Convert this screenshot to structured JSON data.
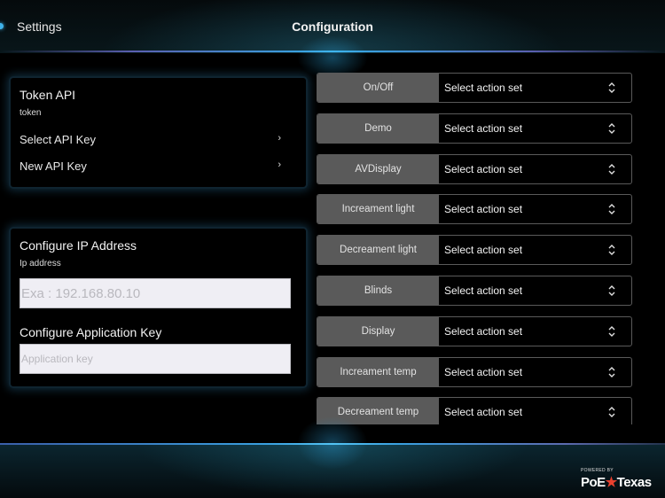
{
  "header": {
    "back_label": "Settings",
    "title": "Configuration"
  },
  "token_card": {
    "title": "Token API",
    "subtitle": "token",
    "items": [
      {
        "label": "Select API Key",
        "icon": "chevron-right-icon"
      },
      {
        "label": "New API Key",
        "icon": "chevron-right-icon"
      }
    ]
  },
  "ip_card": {
    "title": "Configure IP Address",
    "subtitle": "Ip address",
    "ip_input": {
      "value": "",
      "placeholder": "Exa : 192.168.80.10"
    },
    "app_key_title": "Configure Application Key",
    "app_key_input": {
      "value": "",
      "placeholder": "Application key"
    }
  },
  "actions": [
    {
      "name": "On/Off",
      "select": "Select action set"
    },
    {
      "name": "Demo",
      "select": "Select action set"
    },
    {
      "name": "AVDisplay",
      "select": "Select action set"
    },
    {
      "name": "Increament light",
      "select": "Select action set"
    },
    {
      "name": "Decreament light",
      "select": "Select action set"
    },
    {
      "name": "Blinds",
      "select": "Select action set"
    },
    {
      "name": "Display",
      "select": "Select action set"
    },
    {
      "name": "Increament temp",
      "select": "Select action set"
    },
    {
      "name": "Decreament temp",
      "select": "Select action set"
    }
  ],
  "footer": {
    "powered_by": "POWERED BY",
    "brand_left": "PoE",
    "brand_star": "★",
    "brand_right": "Texas"
  },
  "colors": {
    "accent": "#3fb2ea",
    "action_label_bg": "#5a5a5a",
    "input_bg": "#efeef4",
    "brand_star": "#e8402e"
  }
}
